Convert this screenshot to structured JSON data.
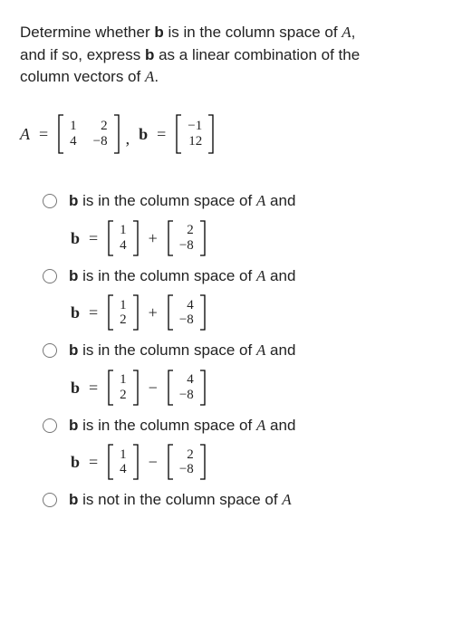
{
  "question": {
    "line1_a": "Determine whether ",
    "line1_b": "b",
    "line1_c": " is in the column space of ",
    "line1_d": "A",
    "line1_e": ",",
    "line2_a": "and if so, express ",
    "line2_b": "b",
    "line2_c": " as a linear combination of the",
    "line3": "column vectors of ",
    "line3_b": "A",
    "line3_c": "."
  },
  "given": {
    "A_label": "A",
    "eq": "=",
    "A": {
      "r1c1": "1",
      "r1c2": "2",
      "r2c1": "4",
      "r2c2": "−8"
    },
    "comma": ",",
    "b_label": "b",
    "b": {
      "r1": "−1",
      "r2": "12"
    }
  },
  "opts": {
    "stem": " is in the column space of ",
    "A": "A",
    "and": " and",
    "not": " is not in the column space of ",
    "b_label": "b",
    "eq": "="
  },
  "opt1": {
    "v1": {
      "r1": "1",
      "r2": "4"
    },
    "op": "+",
    "v2": {
      "r1": "2",
      "r2": "−8"
    }
  },
  "opt2": {
    "v1": {
      "r1": "1",
      "r2": "2"
    },
    "op": "+",
    "v2": {
      "r1": "4",
      "r2": "−8"
    }
  },
  "opt3": {
    "v1": {
      "r1": "1",
      "r2": "2"
    },
    "op": "−",
    "v2": {
      "r1": "4",
      "r2": "−8"
    }
  },
  "opt4": {
    "v1": {
      "r1": "1",
      "r2": "4"
    },
    "op": "−",
    "v2": {
      "r1": "2",
      "r2": "−8"
    }
  }
}
